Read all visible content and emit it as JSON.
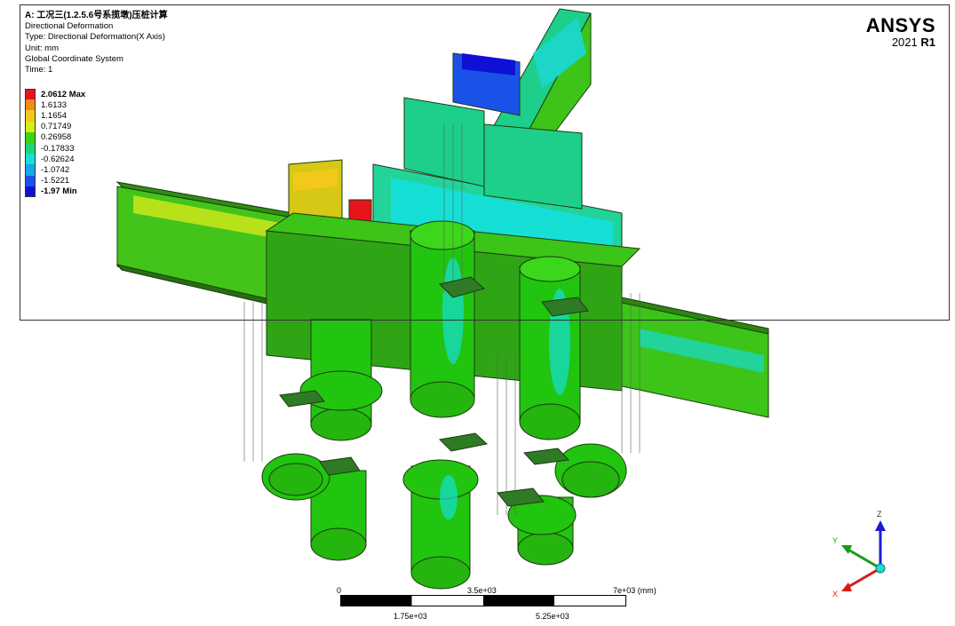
{
  "header": {
    "title": "A: 工况三(1.2.5.6号系揽墩)压桩计算",
    "result": "Directional Deformation",
    "type": "Type: Directional Deformation(X Axis)",
    "unit": "Unit: mm",
    "coords": "Global Coordinate System",
    "time": "Time: 1"
  },
  "legend": {
    "entries": [
      {
        "label": "2.0612 Max",
        "color": "#e8141b",
        "bold": true
      },
      {
        "label": "1.6133",
        "color": "#f28a1a",
        "bold": false
      },
      {
        "label": "1.1654",
        "color": "#f2c81a",
        "bold": false
      },
      {
        "label": "0.71749",
        "color": "#d6ee14",
        "bold": false
      },
      {
        "label": "0.26958",
        "color": "#39d616",
        "bold": false
      },
      {
        "label": "-0.17833",
        "color": "#1ad67a",
        "bold": false
      },
      {
        "label": "-0.62624",
        "color": "#16e0d6",
        "bold": false
      },
      {
        "label": "-1.0742",
        "color": "#17a9e8",
        "bold": false
      },
      {
        "label": "-1.5221",
        "color": "#1a52e8",
        "bold": false
      },
      {
        "label": "-1.97 Min",
        "color": "#0f10d6",
        "bold": true
      }
    ]
  },
  "logo": {
    "brand": "ANSYS",
    "version": "2021",
    "release": "R1"
  },
  "scale": {
    "top_left": "0",
    "top_mid": "3.5e+03",
    "top_right": "7e+03 (mm)",
    "bottom_left": "1.75e+03",
    "bottom_right": "5.25e+03"
  },
  "triad": {
    "z": "Z",
    "y": "Y",
    "x": "X"
  }
}
